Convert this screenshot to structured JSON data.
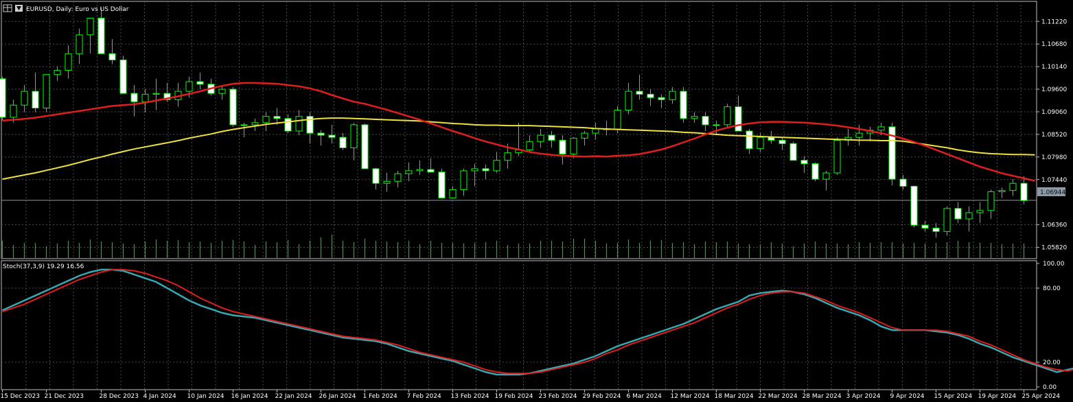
{
  "header": {
    "title": "EURUSD, Daily:  Euro vs US Dollar"
  },
  "indicator": {
    "label": "Stoch(37,3,9) 19.29 16.56"
  },
  "price_badge": "1.06944",
  "colors": {
    "background": "#000000",
    "grid": "#4d4d4d",
    "bull_body": "#000000",
    "bear_body": "#ffffff",
    "wick": "#00ff00",
    "volume": "#00c800",
    "ma_fast": "#e01e1e",
    "ma_slow": "#f0e040",
    "stoch_main": "#3aa6b0",
    "stoch_signal": "#e01e1e",
    "bid_line": "#8a9aa6"
  },
  "chart_data": [
    {
      "type": "candlestick",
      "title": "EURUSD, Daily:  Euro vs US Dollar",
      "y_ticks": [
        "1.11220",
        "1.10680",
        "1.10140",
        "1.09600",
        "1.09060",
        "1.08520",
        "1.07980",
        "1.07440",
        "1.06360",
        "1.05820"
      ],
      "ylim": [
        1.0555,
        1.117
      ],
      "x_tick_labels": [
        "15 Dec 2023",
        "21 Dec 2023",
        "28 Dec 2023",
        "4 Jan 2024",
        "10 Jan 2024",
        "16 Jan 2024",
        "22 Jan 2024",
        "26 Jan 2024",
        "1 Feb 2024",
        "7 Feb 2024",
        "13 Feb 2024",
        "19 Feb 2024",
        "23 Feb 2024",
        "29 Feb 2024",
        "6 Mar 2024",
        "12 Mar 2024",
        "18 Mar 2024",
        "22 Mar 2024",
        "28 Mar 2024",
        "3 Apr 2024",
        "9 Apr 2024",
        "15 Apr 2024",
        "19 Apr 2024",
        "25 Apr 2024"
      ],
      "x_tick_index": [
        0,
        4,
        9,
        13,
        17,
        21,
        25,
        29,
        33,
        37,
        41,
        45,
        49,
        53,
        57,
        61,
        65,
        69,
        73,
        77,
        81,
        85,
        89,
        93
      ],
      "last_price": 1.06944,
      "candles": [
        [
          1.0985,
          1.099,
          1.0885,
          1.0893
        ],
        [
          1.0893,
          1.0935,
          1.088,
          1.0922
        ],
        [
          1.0922,
          1.097,
          1.0905,
          1.0955
        ],
        [
          1.0955,
          1.1,
          1.0905,
          1.0915
        ],
        [
          1.0915,
          1.0995,
          1.0905,
          1.0995
        ],
        [
          1.0995,
          1.1015,
          1.098,
          1.1005
        ],
        [
          1.1005,
          1.1065,
          1.0985,
          1.1045
        ],
        [
          1.1045,
          1.1105,
          1.102,
          1.109
        ],
        [
          1.109,
          1.113,
          1.1045,
          1.113
        ],
        [
          1.113,
          1.1155,
          1.107,
          1.1045
        ],
        [
          1.1045,
          1.108,
          1.102,
          1.103
        ],
        [
          1.103,
          1.104,
          1.095,
          1.095
        ],
        [
          1.095,
          1.097,
          1.0895,
          1.093
        ],
        [
          1.093,
          1.096,
          1.0905,
          1.0948
        ],
        [
          1.0948,
          1.0985,
          1.091,
          1.095
        ],
        [
          1.095,
          1.0975,
          1.093,
          1.0935
        ],
        [
          1.0935,
          1.0975,
          1.0918,
          1.0955
        ],
        [
          1.0955,
          1.099,
          1.094,
          1.0978
        ],
        [
          1.0978,
          1.1,
          1.096,
          1.0972
        ],
        [
          1.0972,
          1.0985,
          1.0945,
          1.095
        ],
        [
          1.095,
          1.097,
          1.0935,
          1.096
        ],
        [
          1.096,
          1.0965,
          1.087,
          1.0875
        ],
        [
          1.0875,
          1.088,
          1.0845,
          1.0875
        ],
        [
          1.0875,
          1.089,
          1.086,
          1.088
        ],
        [
          1.088,
          1.0905,
          1.086,
          1.0895
        ],
        [
          1.0895,
          1.0915,
          1.0875,
          1.089
        ],
        [
          1.089,
          1.09,
          1.0855,
          1.086
        ],
        [
          1.086,
          1.091,
          1.085,
          1.0895
        ],
        [
          1.0895,
          1.0905,
          1.083,
          1.0855
        ],
        [
          1.0855,
          1.0862,
          1.0825,
          1.085
        ],
        [
          1.085,
          1.0875,
          1.083,
          1.0845
        ],
        [
          1.0845,
          1.0855,
          1.0815,
          1.082
        ],
        [
          1.082,
          1.088,
          1.079,
          1.0875
        ],
        [
          1.0875,
          1.0878,
          1.077,
          1.077
        ],
        [
          1.077,
          1.0772,
          1.072,
          1.0735
        ],
        [
          1.0735,
          1.076,
          1.0715,
          1.074
        ],
        [
          1.074,
          1.0765,
          1.0725,
          1.0758
        ],
        [
          1.0758,
          1.0785,
          1.074,
          1.0765
        ],
        [
          1.0765,
          1.079,
          1.0755,
          1.0768
        ],
        [
          1.0768,
          1.0795,
          1.076,
          1.0762
        ],
        [
          1.0762,
          1.077,
          1.07,
          1.07
        ],
        [
          1.07,
          1.0728,
          1.0698,
          1.072
        ],
        [
          1.072,
          1.077,
          1.0705,
          1.0765
        ],
        [
          1.0765,
          1.0782,
          1.0728,
          1.077
        ],
        [
          1.077,
          1.078,
          1.0745,
          1.0765
        ],
        [
          1.0765,
          1.081,
          1.076,
          1.079
        ],
        [
          1.079,
          1.083,
          1.077,
          1.0808
        ],
        [
          1.0808,
          1.088,
          1.08,
          1.0815
        ],
        [
          1.0815,
          1.085,
          1.081,
          1.0835
        ],
        [
          1.0835,
          1.0865,
          1.082,
          1.085
        ],
        [
          1.085,
          1.086,
          1.082,
          1.0838
        ],
        [
          1.0838,
          1.085,
          1.078,
          1.0805
        ],
        [
          1.0805,
          1.0845,
          1.0795,
          1.0843
        ],
        [
          1.0843,
          1.086,
          1.0825,
          1.0855
        ],
        [
          1.0855,
          1.088,
          1.084,
          1.0865
        ],
        [
          1.0865,
          1.0885,
          1.085,
          1.0865
        ],
        [
          1.0865,
          1.092,
          1.0855,
          1.091
        ],
        [
          1.091,
          1.0975,
          1.09,
          1.0955
        ],
        [
          1.0955,
          1.0995,
          1.0935,
          1.0948
        ],
        [
          1.0948,
          1.096,
          1.092,
          1.094
        ],
        [
          1.094,
          1.0948,
          1.0915,
          1.0935
        ],
        [
          1.0935,
          1.0965,
          1.0925,
          1.0955
        ],
        [
          1.0955,
          1.0965,
          1.088,
          1.089
        ],
        [
          1.089,
          1.0905,
          1.088,
          1.0895
        ],
        [
          1.0895,
          1.0905,
          1.086,
          1.0875
        ],
        [
          1.0875,
          1.0885,
          1.085,
          1.0875
        ],
        [
          1.0875,
          1.0925,
          1.087,
          1.0918
        ],
        [
          1.0918,
          1.0945,
          1.0865,
          1.086
        ],
        [
          1.086,
          1.0865,
          1.0805,
          1.0818
        ],
        [
          1.0818,
          1.0855,
          1.081,
          1.0845
        ],
        [
          1.0845,
          1.086,
          1.083,
          1.0838
        ],
        [
          1.0838,
          1.0845,
          1.0815,
          1.083
        ],
        [
          1.083,
          1.0835,
          1.079,
          1.079
        ],
        [
          1.079,
          1.08,
          1.076,
          1.0782
        ],
        [
          1.0782,
          1.0785,
          1.074,
          1.0745
        ],
        [
          1.0745,
          1.0765,
          1.0718,
          1.076
        ],
        [
          1.076,
          1.0845,
          1.0755,
          1.0838
        ],
        [
          1.0838,
          1.0865,
          1.0825,
          1.0845
        ],
        [
          1.0845,
          1.0875,
          1.0825,
          1.0855
        ],
        [
          1.0855,
          1.087,
          1.0835,
          1.0862
        ],
        [
          1.0862,
          1.088,
          1.085,
          1.087
        ],
        [
          1.087,
          1.088,
          1.073,
          1.0745
        ],
        [
          1.0745,
          1.0755,
          1.072,
          1.0728
        ],
        [
          1.0728,
          1.073,
          1.063,
          1.0635
        ],
        [
          1.0635,
          1.0645,
          1.062,
          1.0628
        ],
        [
          1.0628,
          1.064,
          1.0605,
          1.062
        ],
        [
          1.062,
          1.068,
          1.061,
          1.0675
        ],
        [
          1.0675,
          1.069,
          1.064,
          1.065
        ],
        [
          1.065,
          1.068,
          1.062,
          1.0665
        ],
        [
          1.0665,
          1.069,
          1.064,
          1.067
        ],
        [
          1.067,
          1.072,
          1.065,
          1.0715
        ],
        [
          1.0715,
          1.0725,
          1.07,
          1.0718
        ],
        [
          1.0718,
          1.0745,
          1.0705,
          1.0735
        ],
        [
          1.0735,
          1.0752,
          1.0685,
          1.0694
        ]
      ],
      "volume": [
        25,
        19,
        22,
        22,
        17,
        21,
        25,
        22,
        27,
        24,
        23,
        21,
        20,
        24,
        27,
        25,
        26,
        23,
        24,
        22,
        25,
        26,
        24,
        19,
        24,
        23,
        26,
        20,
        25,
        30,
        34,
        25,
        23,
        28,
        25,
        24,
        23,
        25,
        20,
        25,
        22,
        22,
        21,
        22,
        23,
        25,
        19,
        21,
        21,
        25,
        25,
        24,
        28,
        28,
        25,
        21,
        22,
        27,
        22,
        25,
        26,
        22,
        23,
        20,
        24,
        23,
        24,
        21,
        20,
        20,
        23,
        21,
        17,
        21,
        24,
        21,
        21,
        20,
        23,
        22,
        23,
        23,
        21,
        22,
        21,
        22,
        23,
        25,
        23,
        22,
        22,
        20,
        21,
        21
      ],
      "series": [
        {
          "values": [
            1.0885,
            1.0887,
            1.0889,
            1.0892,
            1.0896,
            1.09,
            1.0904,
            1.0908,
            1.0912,
            1.0916,
            1.092,
            1.0922,
            1.0924,
            1.0928,
            1.0933,
            1.0938,
            1.0943,
            1.0949,
            1.0955,
            1.0962,
            1.0968,
            1.0973,
            1.0975,
            1.0975,
            1.0974,
            1.0973,
            1.097,
            1.0967,
            1.0962,
            1.0955,
            1.0946,
            1.0938,
            1.093,
            1.0925,
            1.0918,
            1.0911,
            1.0903,
            1.0895,
            1.0887,
            1.0878,
            1.0869,
            1.086,
            1.0852,
            1.0843,
            1.0835,
            1.0828,
            1.0821,
            1.0816,
            1.081,
            1.0806,
            1.0803,
            1.0801,
            1.08,
            1.0799,
            1.08,
            1.0799,
            1.0801,
            1.0802,
            1.0805,
            1.081,
            1.0816,
            1.0824,
            1.0833,
            1.0842,
            1.0852,
            1.0861,
            1.0868,
            1.0874,
            1.0878,
            1.0881,
            1.0882,
            1.0882,
            1.0881,
            1.088,
            1.0878,
            1.0876,
            1.0873,
            1.0869,
            1.0865,
            1.086,
            1.0855,
            1.0849,
            1.0842,
            1.0834,
            1.0825,
            1.0815,
            1.0805,
            1.0795,
            1.0785,
            1.0775,
            1.0767,
            1.0759,
            1.0753,
            1.0747,
            1.0741
          ]
        },
        {
          "values": [
            1.0745,
            1.075,
            1.0755,
            1.076,
            1.0766,
            1.0772,
            1.0778,
            1.0785,
            1.0792,
            1.0798,
            1.0805,
            1.0811,
            1.0817,
            1.0822,
            1.0827,
            1.0832,
            1.0837,
            1.0843,
            1.0848,
            1.0853,
            1.0859,
            1.0864,
            1.0868,
            1.0872,
            1.0876,
            1.0879,
            1.0882,
            1.0885,
            1.0888,
            1.089,
            1.0891,
            1.0891,
            1.089,
            1.0889,
            1.0888,
            1.0887,
            1.0886,
            1.0885,
            1.0884,
            1.0882,
            1.088,
            1.0878,
            1.0877,
            1.0875,
            1.0874,
            1.0874,
            1.0873,
            1.0873,
            1.0873,
            1.0872,
            1.0871,
            1.087,
            1.0869,
            1.0868,
            1.0866,
            1.0865,
            1.0864,
            1.0863,
            1.0862,
            1.0861,
            1.086,
            1.0859,
            1.0857,
            1.0856,
            1.0854,
            1.0852,
            1.085,
            1.0849,
            1.0848,
            1.0847,
            1.0846,
            1.0845,
            1.0844,
            1.0843,
            1.0842,
            1.0841,
            1.084,
            1.0839,
            1.0838,
            1.0838,
            1.0837,
            1.0837,
            1.0836,
            1.0832,
            1.0828,
            1.0824,
            1.082,
            1.0815,
            1.0811,
            1.0808,
            1.0806,
            1.0805,
            1.0804,
            1.0804,
            1.0803
          ]
        }
      ]
    },
    {
      "type": "line",
      "title": "Stoch(37,3,9) 19.29 16.56",
      "ylim": [
        0,
        100
      ],
      "y_ticks": [
        "100.00",
        "80.00",
        "20.00",
        "0.00"
      ],
      "series": [
        {
          "values": [
            62,
            66,
            70,
            74,
            78,
            82,
            86,
            90,
            93,
            95,
            95,
            94,
            91,
            88,
            85,
            80,
            75,
            70,
            66,
            63,
            60,
            58,
            57,
            56,
            54,
            52,
            50,
            48,
            46,
            44,
            42,
            40,
            39,
            38,
            37,
            35,
            32,
            29,
            27,
            25,
            23,
            21,
            18,
            15,
            12,
            10,
            10,
            10,
            11,
            13,
            15,
            17,
            19,
            22,
            25,
            29,
            33,
            36,
            39,
            42,
            45,
            48,
            51,
            55,
            59,
            63,
            66,
            69,
            74,
            76,
            77,
            78,
            77,
            75,
            72,
            68,
            64,
            61,
            58,
            54,
            49,
            46,
            46,
            46,
            46,
            45,
            44,
            42,
            39,
            35,
            32,
            28,
            24,
            21,
            18,
            15,
            12,
            14,
            16,
            19
          ]
        },
        {
          "values": [
            61,
            64,
            67,
            71,
            75,
            79,
            83,
            87,
            90,
            93,
            95,
            95,
            94,
            92,
            89,
            86,
            82,
            77,
            72,
            68,
            64,
            61,
            59,
            57,
            55,
            53,
            51,
            49,
            47,
            45,
            43,
            41,
            40,
            39,
            38,
            36,
            34,
            31,
            28,
            26,
            24,
            22,
            20,
            17,
            14,
            12,
            11,
            11,
            11,
            12,
            14,
            16,
            18,
            20,
            23,
            27,
            30,
            34,
            37,
            40,
            43,
            46,
            49,
            52,
            56,
            60,
            64,
            67,
            71,
            74,
            76,
            77,
            77,
            76,
            73,
            70,
            66,
            63,
            60,
            56,
            52,
            48,
            46,
            46,
            46,
            46,
            45,
            43,
            41,
            37,
            34,
            30,
            26,
            22,
            19,
            16,
            14,
            13,
            15,
            17
          ]
        }
      ]
    }
  ]
}
